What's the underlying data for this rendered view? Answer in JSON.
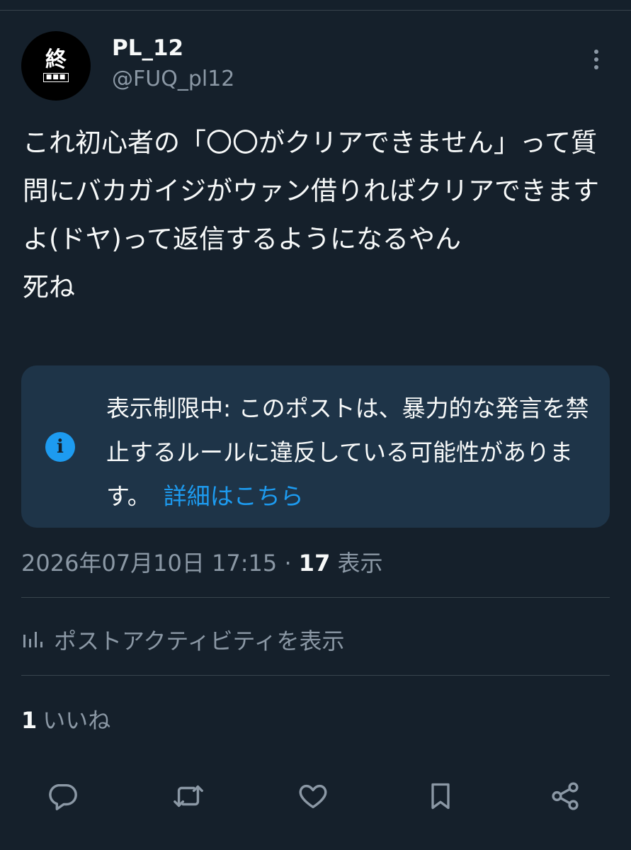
{
  "author": {
    "display_name": "PL_12",
    "handle": "@FUQ_pl12",
    "avatar_glyph": "終",
    "avatar_sub": "■■■"
  },
  "tweet": {
    "text": "これ初心者の「〇〇がクリアできません」って質問にバカガイジがウァン借りればクリアできますよ(ドヤ)って返信するようになるやん\n死ね"
  },
  "notice": {
    "icon": "info-icon",
    "text": "表示制限中: このポストは、暴力的な発言を禁止するルールに違反している可能性があります。",
    "link": "詳細はこちら"
  },
  "meta": {
    "timestamp": "2026年07月10日 17:15",
    "separator": "·",
    "views_count": "17",
    "views_label": "表示"
  },
  "activity": {
    "label": "ポストアクティビティを表示",
    "icon": "bar-chart-icon"
  },
  "likes": {
    "count": "1",
    "label": "いいね"
  },
  "actions": [
    "reply-icon",
    "repost-icon",
    "like-icon",
    "bookmark-icon",
    "share-icon"
  ],
  "colors": {
    "background": "#15202b",
    "notice_bg": "#1e3448",
    "accent": "#1d9bf0",
    "secondary_text": "#8b98a5",
    "divider": "#38444d"
  }
}
